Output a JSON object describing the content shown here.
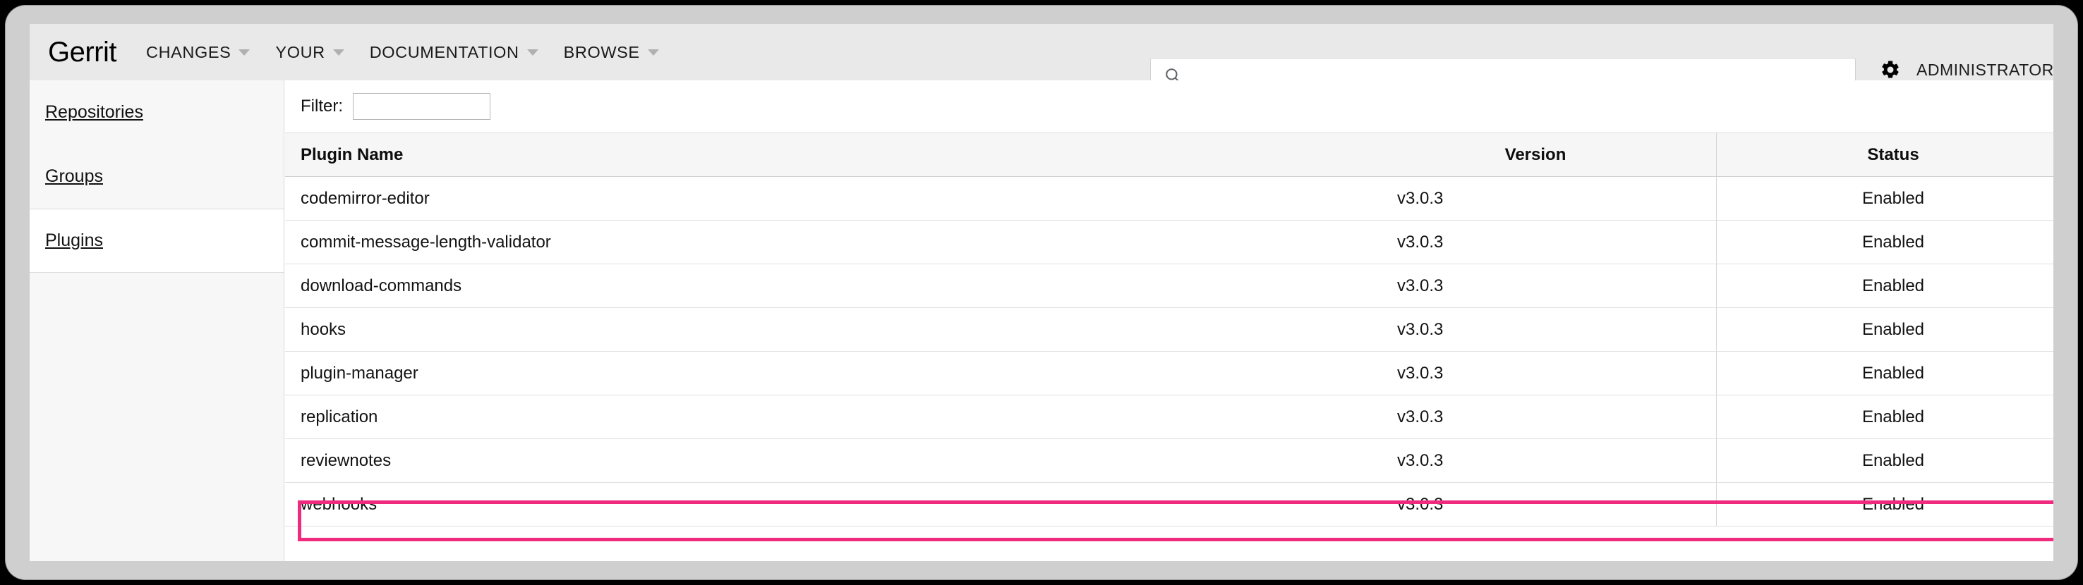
{
  "header": {
    "brand": "Gerrit",
    "nav": [
      {
        "label": "CHANGES",
        "icon": "chevron-down-icon"
      },
      {
        "label": "YOUR",
        "icon": "chevron-down-icon"
      },
      {
        "label": "DOCUMENTATION",
        "icon": "chevron-down-icon"
      },
      {
        "label": "BROWSE",
        "icon": "chevron-down-icon"
      }
    ],
    "search": {
      "icon": "search-icon",
      "value": "",
      "placeholder": ""
    },
    "account": {
      "icon": "gear-icon",
      "label": "ADMINISTRATOR"
    }
  },
  "sidebar": {
    "items": [
      {
        "label": "Repositories",
        "selected": false
      },
      {
        "label": "Groups",
        "selected": false
      },
      {
        "label": "Plugins",
        "selected": true
      }
    ]
  },
  "main": {
    "filter": {
      "label": "Filter:",
      "value": "",
      "placeholder": ""
    },
    "table": {
      "columns": [
        "Plugin Name",
        "Version",
        "Status"
      ],
      "rows": [
        {
          "name": "codemirror-editor",
          "version": "v3.0.3",
          "status": "Enabled",
          "highlighted": false
        },
        {
          "name": "commit-message-length-validator",
          "version": "v3.0.3",
          "status": "Enabled",
          "highlighted": false
        },
        {
          "name": "download-commands",
          "version": "v3.0.3",
          "status": "Enabled",
          "highlighted": false
        },
        {
          "name": "hooks",
          "version": "v3.0.3",
          "status": "Enabled",
          "highlighted": false
        },
        {
          "name": "plugin-manager",
          "version": "v3.0.3",
          "status": "Enabled",
          "highlighted": false
        },
        {
          "name": "replication",
          "version": "v3.0.3",
          "status": "Enabled",
          "highlighted": false
        },
        {
          "name": "reviewnotes",
          "version": "v3.0.3",
          "status": "Enabled",
          "highlighted": false
        },
        {
          "name": "webhooks",
          "version": "v3.0.3",
          "status": "Enabled",
          "highlighted": true
        }
      ]
    }
  },
  "colors": {
    "highlight": "#f02b7e",
    "header_bg": "#e9e9e9",
    "table_header_bg": "#f6f6f6",
    "sidebar_bg": "#f7f7f7"
  }
}
